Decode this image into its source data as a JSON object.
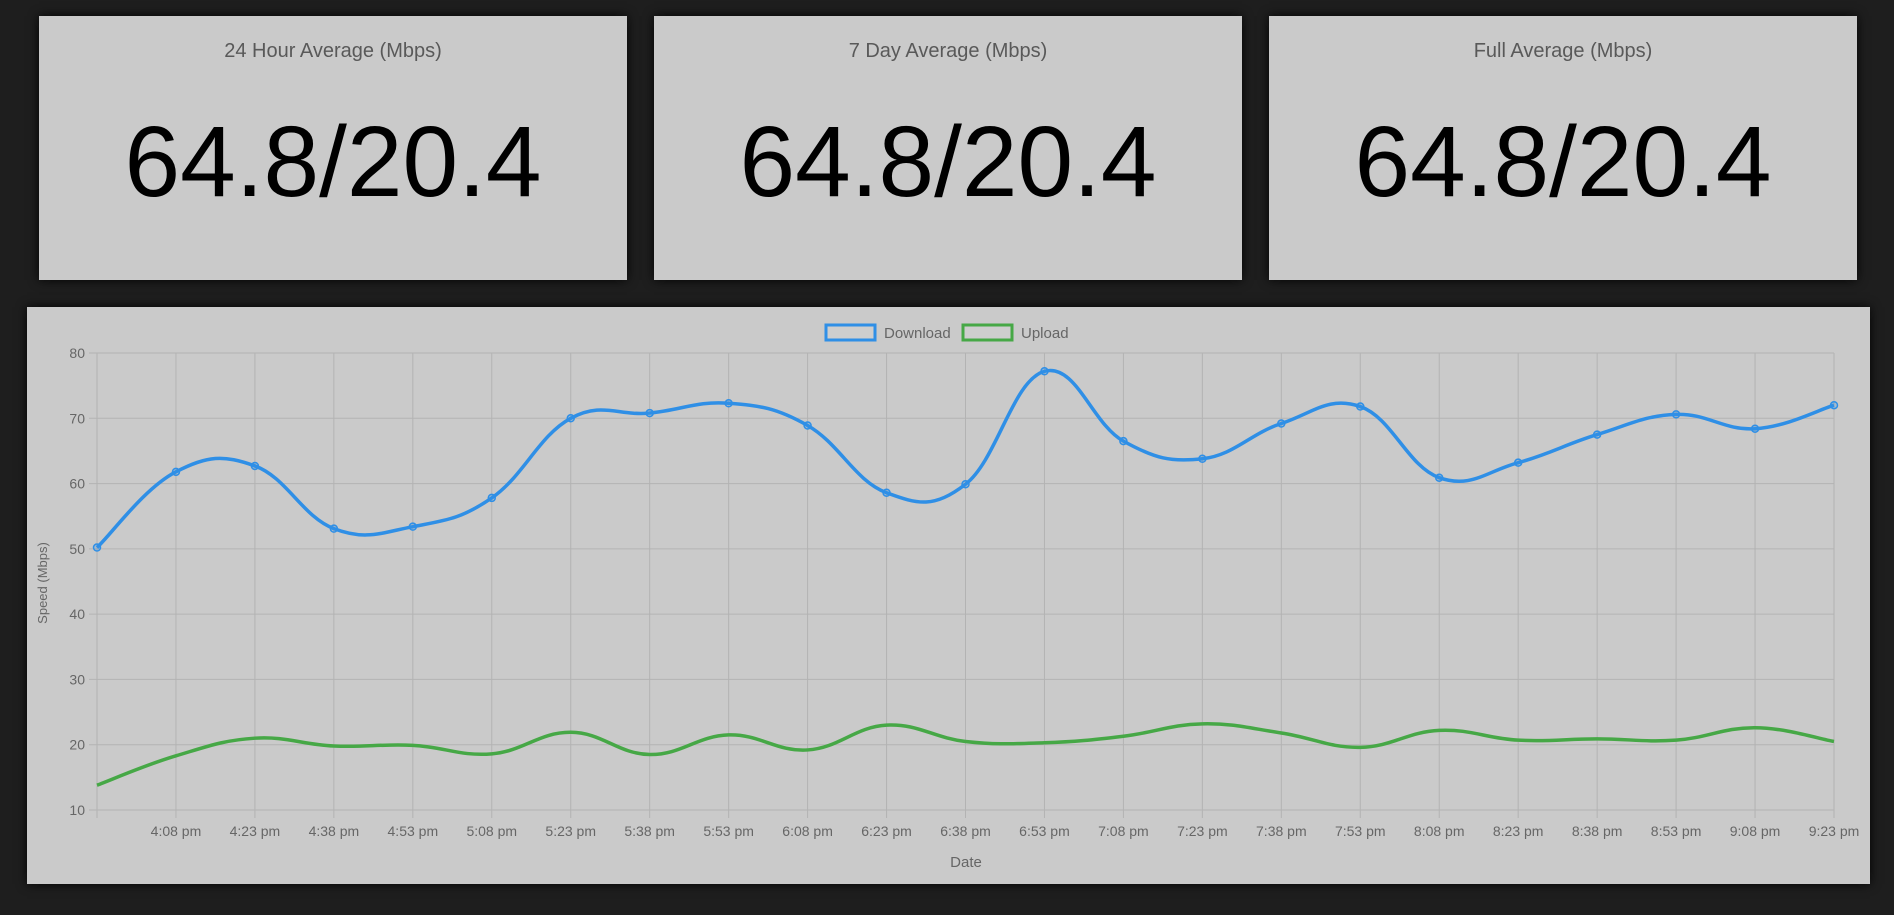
{
  "stats": [
    {
      "title": "24 Hour Average (Mbps)",
      "value": "64.8/20.4"
    },
    {
      "title": "7 Day Average (Mbps)",
      "value": "64.8/20.4"
    },
    {
      "title": "Full Average (Mbps)",
      "value": "64.8/20.4"
    }
  ],
  "colors": {
    "page_background": "#1e1e1e",
    "card_background": "#cacaca",
    "download": "#2f8fe6",
    "upload": "#46a846",
    "grid": "#b3b3b3",
    "text": "#666666"
  },
  "chart_data": {
    "type": "line",
    "title": "",
    "xlabel": "Date",
    "ylabel": "Speed (Mbps)",
    "ylim": [
      10,
      80
    ],
    "yticks": [
      10,
      20,
      30,
      40,
      50,
      60,
      70,
      80
    ],
    "grid": true,
    "legend_position": "top-center",
    "x_tick_labels": [
      "",
      "4:08 pm",
      "4:23 pm",
      "4:38 pm",
      "4:53 pm",
      "5:08 pm",
      "5:23 pm",
      "5:38 pm",
      "5:53 pm",
      "6:08 pm",
      "6:23 pm",
      "6:38 pm",
      "6:53 pm",
      "7:08 pm",
      "7:23 pm",
      "7:38 pm",
      "7:53 pm",
      "8:08 pm",
      "8:23 pm",
      "8:38 pm",
      "8:53 pm",
      "9:08 pm",
      "9:23 pm"
    ],
    "series": [
      {
        "name": "Download",
        "color": "#2f8fe6",
        "show_points": true,
        "values": [
          50.2,
          61.8,
          62.7,
          53.1,
          53.4,
          57.8,
          70.0,
          70.8,
          72.3,
          68.9,
          58.6,
          59.9,
          77.2,
          66.5,
          63.8,
          69.2,
          71.8,
          60.9,
          63.2,
          67.5,
          70.6,
          68.4,
          72.0
        ]
      },
      {
        "name": "Upload",
        "color": "#46a846",
        "show_points": false,
        "values": [
          13.8,
          18.3,
          21.0,
          19.8,
          19.9,
          18.6,
          21.9,
          18.5,
          21.5,
          19.2,
          23.0,
          20.5,
          20.3,
          21.3,
          23.2,
          21.8,
          19.6,
          22.2,
          20.7,
          20.9,
          20.7,
          22.6,
          20.5
        ]
      }
    ]
  }
}
